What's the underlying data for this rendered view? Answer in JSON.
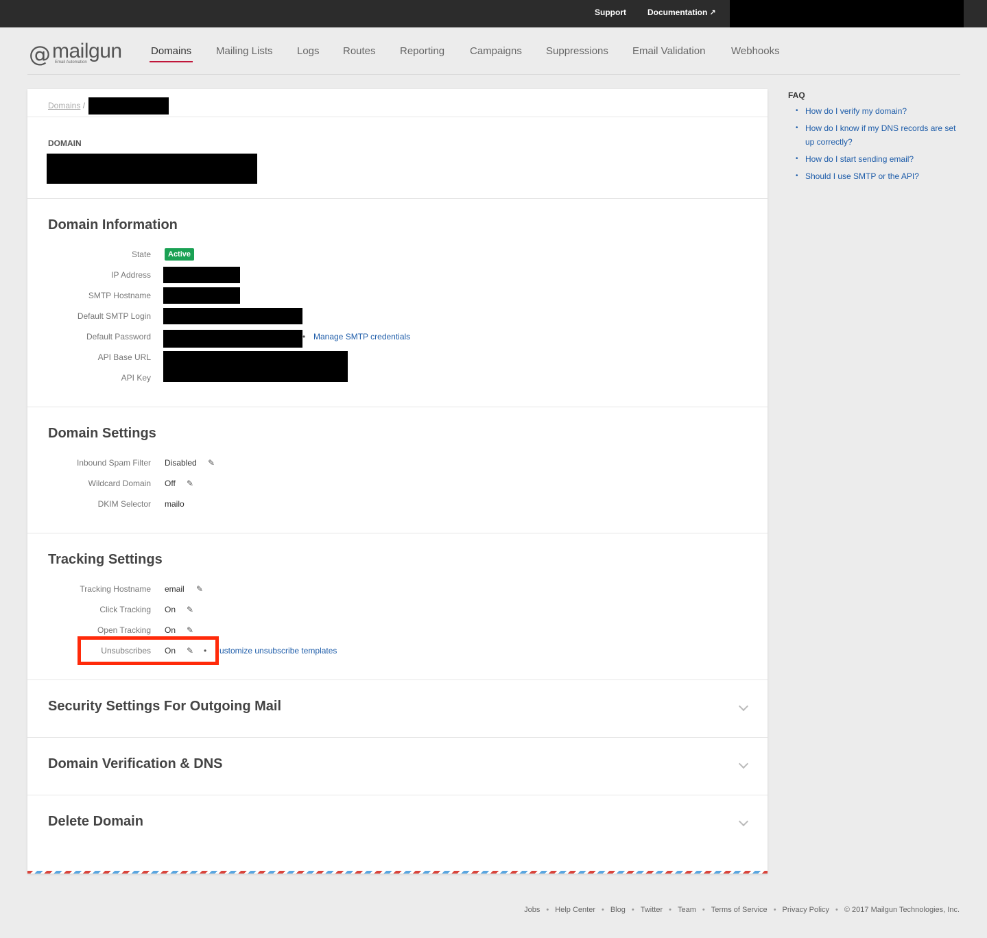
{
  "topbar": {
    "support": "Support",
    "documentation": "Documentation",
    "external_icon": "↗"
  },
  "logo": {
    "at": "@",
    "word": "mailgun",
    "tagline": "Email Automation"
  },
  "nav": {
    "items": [
      {
        "label": "Domains",
        "active": true
      },
      {
        "label": "Mailing Lists"
      },
      {
        "label": "Logs"
      },
      {
        "label": "Routes"
      },
      {
        "label": "Reporting"
      },
      {
        "label": "Campaigns"
      },
      {
        "label": "Suppressions"
      },
      {
        "label": "Email Validation"
      },
      {
        "label": "Webhooks"
      }
    ]
  },
  "breadcrumb": {
    "root": "Domains",
    "separator": "/"
  },
  "domain": {
    "label": "DOMAIN"
  },
  "domain_information": {
    "title": "Domain Information",
    "state_label": "State",
    "state_value": "Active",
    "ip_label": "IP Address",
    "smtp_host_label": "SMTP Hostname",
    "smtp_login_label": "Default SMTP Login",
    "password_label": "Default Password",
    "manage_smtp_link": "Manage SMTP credentials",
    "api_base_label": "API Base URL",
    "api_key_label": "API Key"
  },
  "domain_settings": {
    "title": "Domain Settings",
    "spam_label": "Inbound Spam Filter",
    "spam_value": "Disabled",
    "wildcard_label": "Wildcard Domain",
    "wildcard_value": "Off",
    "dkim_label": "DKIM Selector",
    "dkim_value": "mailo"
  },
  "tracking_settings": {
    "title": "Tracking Settings",
    "hostname_label": "Tracking Hostname",
    "hostname_value": "email",
    "click_label": "Click Tracking",
    "click_value": "On",
    "open_label": "Open Tracking",
    "open_value": "On",
    "unsub_label": "Unsubscribes",
    "unsub_value": "On",
    "customize_link": "ustomize unsubscribe templates"
  },
  "collapsed_sections": {
    "security": "Security Settings For Outgoing Mail",
    "verification": "Domain Verification & DNS",
    "delete": "Delete Domain"
  },
  "faq": {
    "title": "FAQ",
    "items": [
      "How do I verify my domain?",
      "How do I know if my DNS records are set up correctly?",
      "How do I start sending email?",
      "Should I use SMTP or the API?"
    ]
  },
  "footer": {
    "jobs": "Jobs",
    "help": "Help Center",
    "blog": "Blog",
    "twitter": "Twitter",
    "team": "Team",
    "terms": "Terms of Service",
    "privacy": "Privacy Policy",
    "copyright": "© 2017 Mailgun Technologies, Inc."
  },
  "colors": {
    "accent": "#c0163a",
    "active_badge": "#1aa154",
    "link": "#1d5ca9",
    "highlight": "#ff2a0a"
  }
}
